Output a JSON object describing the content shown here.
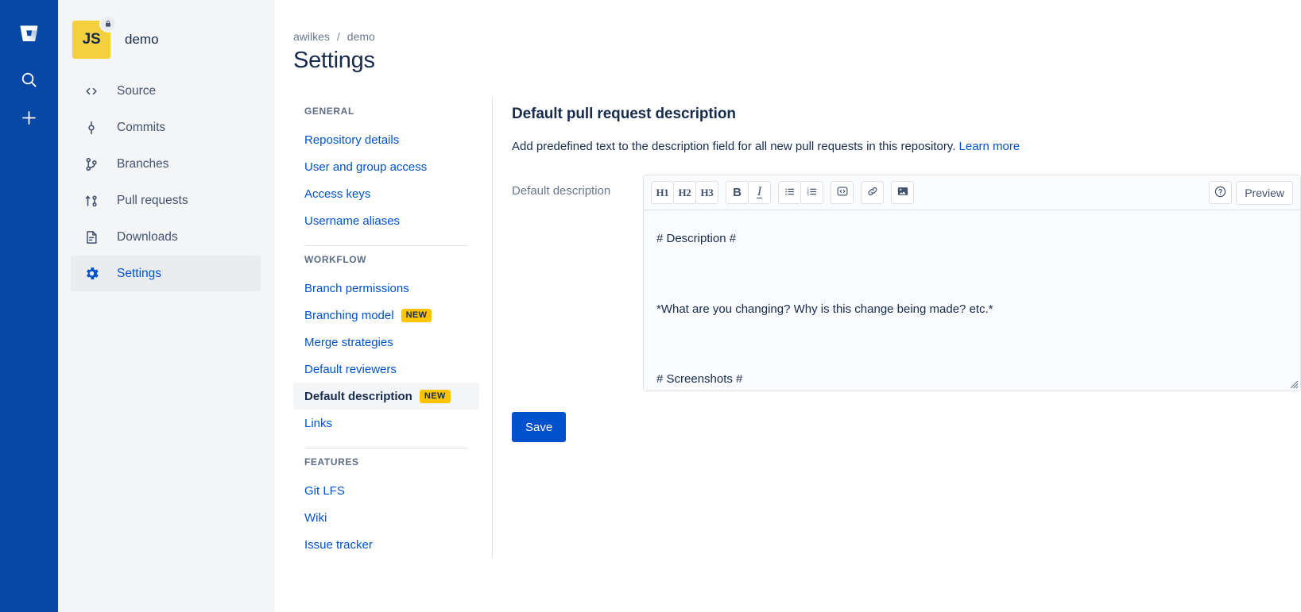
{
  "colors": {
    "rail_blue": "#0747A6",
    "link_blue": "#0052CC",
    "badge_yellow": "#FFC400",
    "avatar_yellow": "#F4D03F",
    "text_dark": "#172B4D",
    "text_subtle": "#6B778C"
  },
  "global_rail": {
    "items": [
      {
        "icon": "bitbucket-logo-icon",
        "label": "Bitbucket"
      },
      {
        "icon": "search-icon",
        "label": "Search"
      },
      {
        "icon": "plus-icon",
        "label": "Create"
      }
    ]
  },
  "sidebar": {
    "repo": {
      "avatar_initials": "JS",
      "name": "demo",
      "lock_icon": "lock-icon"
    },
    "items": [
      {
        "label": "Source",
        "icon": "code-brackets-icon",
        "selected": false
      },
      {
        "label": "Commits",
        "icon": "commit-icon",
        "selected": false
      },
      {
        "label": "Branches",
        "icon": "branch-icon",
        "selected": false
      },
      {
        "label": "Pull requests",
        "icon": "pull-request-icon",
        "selected": false
      },
      {
        "label": "Downloads",
        "icon": "file-download-icon",
        "selected": false
      },
      {
        "label": "Settings",
        "icon": "gear-icon",
        "selected": true
      }
    ]
  },
  "breadcrumb": {
    "workspace": "awilkes",
    "separator": "/",
    "repo": "demo"
  },
  "page": {
    "title": "Settings"
  },
  "settings_nav": {
    "sections": [
      {
        "title": "GENERAL",
        "items": [
          {
            "label": "Repository details",
            "badge": "",
            "active": false
          },
          {
            "label": "User and group access",
            "badge": "",
            "active": false
          },
          {
            "label": "Access keys",
            "badge": "",
            "active": false
          },
          {
            "label": "Username aliases",
            "badge": "",
            "active": false
          }
        ]
      },
      {
        "title": "WORKFLOW",
        "items": [
          {
            "label": "Branch permissions",
            "badge": "",
            "active": false
          },
          {
            "label": "Branching model",
            "badge": "NEW",
            "active": false
          },
          {
            "label": "Merge strategies",
            "badge": "",
            "active": false
          },
          {
            "label": "Default reviewers",
            "badge": "",
            "active": false
          },
          {
            "label": "Default description",
            "badge": "NEW",
            "active": true
          },
          {
            "label": "Links",
            "badge": "",
            "active": false
          }
        ]
      },
      {
        "title": "FEATURES",
        "items": [
          {
            "label": "Git LFS",
            "badge": "",
            "active": false
          },
          {
            "label": "Wiki",
            "badge": "",
            "active": false
          },
          {
            "label": "Issue tracker",
            "badge": "",
            "active": false
          }
        ]
      }
    ]
  },
  "panel": {
    "title": "Default pull request description",
    "description_text": "Add predefined text to the description field for all new pull requests in this repository. ",
    "description_link": "Learn more",
    "field_label": "Default description",
    "editor": {
      "toolbar": {
        "groups": [
          [
            {
              "name": "heading-1-button",
              "label": "H1"
            },
            {
              "name": "heading-2-button",
              "label": "H2"
            },
            {
              "name": "heading-3-button",
              "label": "H3"
            }
          ],
          [
            {
              "name": "bold-button",
              "label": "B"
            },
            {
              "name": "italic-button",
              "label": "I"
            }
          ],
          [
            {
              "name": "bulleted-list-button",
              "label": "bulleted-list-icon"
            },
            {
              "name": "numbered-list-button",
              "label": "numbered-list-icon"
            }
          ],
          [
            {
              "name": "code-block-button",
              "label": "code-icon"
            }
          ],
          [
            {
              "name": "link-button",
              "label": "link-icon"
            }
          ],
          [
            {
              "name": "image-button",
              "label": "image-icon"
            }
          ]
        ],
        "help_icon": "question-circle-icon",
        "preview_label": "Preview"
      },
      "value": "# Description #\n\n*What are you changing? Why is this change being made? etc.*\n\n# Screenshots #\n\n*If you're changing UX behavior, add screenshots or GIFs indicating your changes.*\n\n# Testing notes #",
      "placeholder": ""
    },
    "save_label": "Save"
  }
}
